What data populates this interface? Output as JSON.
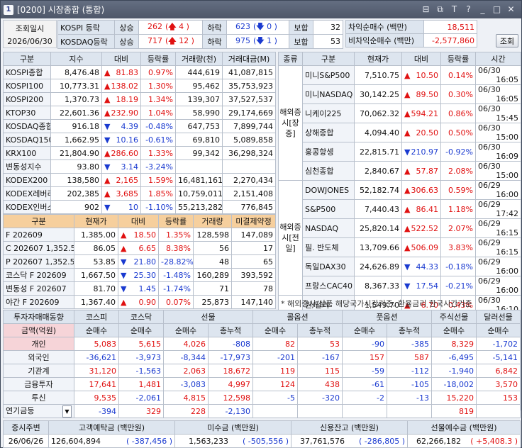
{
  "window": {
    "title": "[0200] 시장종합 (통합)",
    "icon_text": "1"
  },
  "query": {
    "label": "조회일시",
    "date": "2026/06/30",
    "button": "조회"
  },
  "breadth": [
    {
      "market": "KOSPI 등락",
      "up_label": "상승",
      "up": "262",
      "limit_up": "4",
      "down_label": "하락",
      "down": "623",
      "limit_down": "0",
      "flat_label": "보합",
      "flat": "32"
    },
    {
      "market": "KOSDAQ등락",
      "up_label": "상승",
      "up": "717",
      "limit_up": "12",
      "down_label": "하락",
      "down": "975",
      "limit_down": "1",
      "flat_label": "보합",
      "flat": "53"
    }
  ],
  "arb": [
    {
      "label": "차익순매수 (백만)",
      "value": "18,511"
    },
    {
      "label": "비차익순매수 (백만)",
      "value": "-2,577,860"
    }
  ],
  "index_table": {
    "headers": [
      "구분",
      "지수",
      "대비",
      "등락률",
      "거래량(천)",
      "거래대금(M)"
    ],
    "rows": [
      {
        "name": "KOSPI종합",
        "value": "8,476.48",
        "dir": "up",
        "chg": "81.83",
        "rate": "0.97%",
        "vol": "444,619",
        "amt": "41,087,815"
      },
      {
        "name": "KOSPI100",
        "value": "10,773.31",
        "dir": "up",
        "chg": "138.02",
        "rate": "1.30%",
        "vol": "95,462",
        "amt": "35,753,923"
      },
      {
        "name": "KOSPI200",
        "value": "1,370.73",
        "dir": "up",
        "chg": "18.19",
        "rate": "1.34%",
        "vol": "139,307",
        "amt": "37,527,537"
      },
      {
        "name": "KTOP30",
        "value": "22,601.36",
        "dir": "up",
        "chg": "232.90",
        "rate": "1.04%",
        "vol": "58,990",
        "amt": "29,174,669"
      },
      {
        "name": "KOSDAQ종합",
        "value": "916.18",
        "dir": "down",
        "chg": "4.39",
        "rate": "-0.48%",
        "vol": "647,753",
        "amt": "7,899,744"
      },
      {
        "name": "KOSDAQ150",
        "value": "1,662.95",
        "dir": "down",
        "chg": "10.16",
        "rate": "-0.61%",
        "vol": "69,810",
        "amt": "5,089,858"
      },
      {
        "name": "KRX100",
        "value": "21,804.90",
        "dir": "up",
        "chg": "286.60",
        "rate": "1.33%",
        "vol": "99,342",
        "amt": "36,298,324"
      },
      {
        "name": "변동성지수",
        "value": "93.80",
        "dir": "down",
        "chg": "3.14",
        "rate": "-3.24%",
        "vol": "",
        "amt": ""
      },
      {
        "name": "KODEX200",
        "value": "138,580",
        "dir": "up",
        "chg": "2,165",
        "rate": "1.59%",
        "vol": "16,481,161",
        "amt": "2,270,434"
      },
      {
        "name": "KODEX레버리",
        "value": "202,385",
        "dir": "up",
        "chg": "3,685",
        "rate": "1.85%",
        "vol": "10,759,011",
        "amt": "2,151,408"
      },
      {
        "name": "KODEX인버스",
        "value": "902",
        "dir": "down",
        "chg": "10",
        "rate": "-1.10%",
        "vol": "55,213,282",
        "amt": "776,845"
      }
    ]
  },
  "deriv_table": {
    "headers": [
      "구분",
      "현재가",
      "대비",
      "등락률",
      "거래량",
      "미결제약정"
    ],
    "rows": [
      {
        "name": "F 202609",
        "value": "1,385.00",
        "dir": "up",
        "chg": "18.50",
        "rate": "1.35%",
        "vol": "128,598",
        "oi": "147,089"
      },
      {
        "name": "C 202607 1,352.5",
        "value": "86.05",
        "dir": "up",
        "chg": "6.65",
        "rate": "8.38%",
        "vol": "56",
        "oi": "17"
      },
      {
        "name": "P 202607 1,352.5",
        "value": "53.85",
        "dir": "down",
        "chg": "21.80",
        "rate": "-28.82%",
        "vol": "48",
        "oi": "65"
      },
      {
        "name": "코스닥 F 202609",
        "value": "1,667.50",
        "dir": "down",
        "chg": "25.30",
        "rate": "-1.48%",
        "vol": "160,289",
        "oi": "393,592"
      },
      {
        "name": "변동성 F 202607",
        "value": "81.70",
        "dir": "down",
        "chg": "1.45",
        "rate": "-1.74%",
        "vol": "71",
        "oi": "78"
      },
      {
        "name": "야간 F 202609",
        "value": "1,367.40",
        "dir": "up",
        "chg": "0.90",
        "rate": "0.07%",
        "vol": "25,873",
        "oi": "147,140"
      }
    ]
  },
  "global_table": {
    "headers": [
      "종류",
      "구분",
      "현재가",
      "대비",
      "등락률",
      "시간"
    ],
    "groups": [
      {
        "category": "해외증시[장중]",
        "rows": [
          {
            "name": "미니S&P500",
            "value": "7,510.75",
            "dir": "up",
            "chg": "10.50",
            "rate": "0.14%",
            "date": "06/30",
            "time": "16:05"
          },
          {
            "name": "미니NASDAQ",
            "value": "30,142.25",
            "dir": "up",
            "chg": "89.50",
            "rate": "0.30%",
            "date": "06/30",
            "time": "16:05"
          },
          {
            "name": "니케이225",
            "value": "70,062.32",
            "dir": "up",
            "chg": "594.21",
            "rate": "0.86%",
            "date": "06/30",
            "time": "15:45"
          },
          {
            "name": "상해종합",
            "value": "4,094.40",
            "dir": "up",
            "chg": "20.50",
            "rate": "0.50%",
            "date": "06/30",
            "time": "15:00"
          },
          {
            "name": "홍콩항셍",
            "value": "22,815.71",
            "dir": "down",
            "chg": "210.97",
            "rate": "-0.92%",
            "date": "06/30",
            "time": "16:09"
          },
          {
            "name": "심천종합",
            "value": "2,840.67",
            "dir": "up",
            "chg": "57.87",
            "rate": "2.08%",
            "date": "06/30",
            "time": "15:00"
          }
        ]
      },
      {
        "category": "해외증시[전일]",
        "rows": [
          {
            "name": "DOWJONES",
            "value": "52,182.74",
            "dir": "up",
            "chg": "306.63",
            "rate": "0.59%",
            "date": "06/29",
            "time": "16:00"
          },
          {
            "name": "S&P500",
            "value": "7,440.43",
            "dir": "up",
            "chg": "86.41",
            "rate": "1.18%",
            "date": "06/29",
            "time": "17:42"
          },
          {
            "name": "NASDAQ",
            "value": "25,820.14",
            "dir": "up",
            "chg": "522.52",
            "rate": "2.07%",
            "date": "06/29",
            "time": "16:15"
          },
          {
            "name": "필. 반도체",
            "value": "13,709.66",
            "dir": "up",
            "chg": "506.09",
            "rate": "3.83%",
            "date": "06/29",
            "time": "16:15"
          },
          {
            "name": "독일DAX30",
            "value": "24,626.89",
            "dir": "down",
            "chg": "44.33",
            "rate": "-0.18%",
            "date": "06/29",
            "time": "16:00"
          },
          {
            "name": "프랑스CAC40",
            "value": "8,367.33",
            "dir": "down",
            "chg": "17.54",
            "rate": "-0.21%",
            "date": "06/29",
            "time": "16:00"
          }
        ]
      },
      {
        "category": "환율금리[장중]",
        "rows": [
          {
            "name": "원/달러",
            "value": "1,549.70",
            "dir": "up",
            "chg": "6.70",
            "rate": "0.43%",
            "date": "06/30",
            "time": "16:10"
          },
          {
            "name": "엔/달러",
            "value": "161.93",
            "dir": "up",
            "chg": "0.20",
            "rate": "0.12%",
            "date": "06/29",
            "time": "16:00"
          },
          {
            "name": "국고채3년",
            "value": "3.73",
            "dir": "up",
            "chg": "0.01",
            "rate": "0.27%",
            "date": "06/29",
            "time": "16:00"
          },
          {
            "name": "CD [91일]",
            "value": "2.92",
            "dir": "",
            "chg": "",
            "rate": "",
            "date": "06/29",
            "time": "16:00"
          }
        ]
      },
      {
        "category": "상품",
        "rows": [
          {
            "name": "WTI 유가",
            "value": "70.75",
            "dir": "up",
            "chg": "1.52",
            "rate": "2.19%",
            "date": "06/29",
            "time": "16:00"
          },
          {
            "name": "금",
            "value": "4,038.90",
            "dir": "down",
            "chg": "57.40",
            "rate": "-1.40%",
            "date": "06/29",
            "time": "16:00"
          }
        ]
      }
    ],
    "note": "* 해외증시/상품 해당국가시간기준, 환율금리 한국시간기준"
  },
  "investor_table": {
    "corner": "투자자매매동향",
    "unit": "금액(억원)",
    "groups": [
      "코스피",
      "코스닥",
      "선물",
      "콜옵션",
      "풋옵션",
      "주식선물",
      "달러선물"
    ],
    "subheaders": [
      "순매수",
      "순매수",
      "순매수",
      "총누적",
      "순매수",
      "총누적",
      "순매수",
      "총누적",
      "순매수",
      "순매수"
    ],
    "rows": [
      {
        "name": "개인",
        "cells": [
          "5,083",
          "5,615",
          "4,026",
          "-808",
          "82",
          "53",
          "-90",
          "-385",
          "8,329",
          "-1,702"
        ]
      },
      {
        "name": "외국인",
        "cells": [
          "-36,621",
          "-3,973",
          "-8,344",
          "-17,973",
          "-201",
          "-167",
          "157",
          "587",
          "-6,495",
          "-5,141"
        ]
      },
      {
        "name": "기관계",
        "cells": [
          "31,120",
          "-1,563",
          "2,063",
          "18,672",
          "119",
          "115",
          "-59",
          "-112",
          "-1,940",
          "6,842"
        ]
      },
      {
        "name": "금융투자",
        "cells": [
          "17,641",
          "1,481",
          "-3,083",
          "4,997",
          "124",
          "438",
          "-61",
          "-105",
          "-18,002",
          "3,570"
        ]
      },
      {
        "name": "투신",
        "cells": [
          "9,535",
          "-2,061",
          "4,815",
          "12,598",
          "-5",
          "-320",
          "-2",
          "-13",
          "15,220",
          "153"
        ]
      },
      {
        "name": "연기금등",
        "cells": [
          "-394",
          "329",
          "228",
          "-2,130",
          "",
          "",
          "",
          "",
          "819",
          ""
        ]
      }
    ]
  },
  "bottom": {
    "headers": [
      "증시주변",
      "고객예탁금 (백만원)",
      "미수금 (백만원)",
      "신용잔고 (백만원)",
      "선물예수금 (백만원)"
    ],
    "date": "26/06/26",
    "deposit": "126,604,894",
    "deposit_chg": "-387,456",
    "receivable": "1,563,233",
    "receivable_chg": "-505,556",
    "credit": "37,761,576",
    "credit_chg": "-286,805",
    "futures": "62,266,182",
    "futures_chg": "+5,408.3"
  },
  "colors": {
    "up": "#e01010",
    "down": "#1a3ad0",
    "header": "#dde5ef",
    "orange": "#f6cf9d",
    "title": "#4e5769"
  }
}
